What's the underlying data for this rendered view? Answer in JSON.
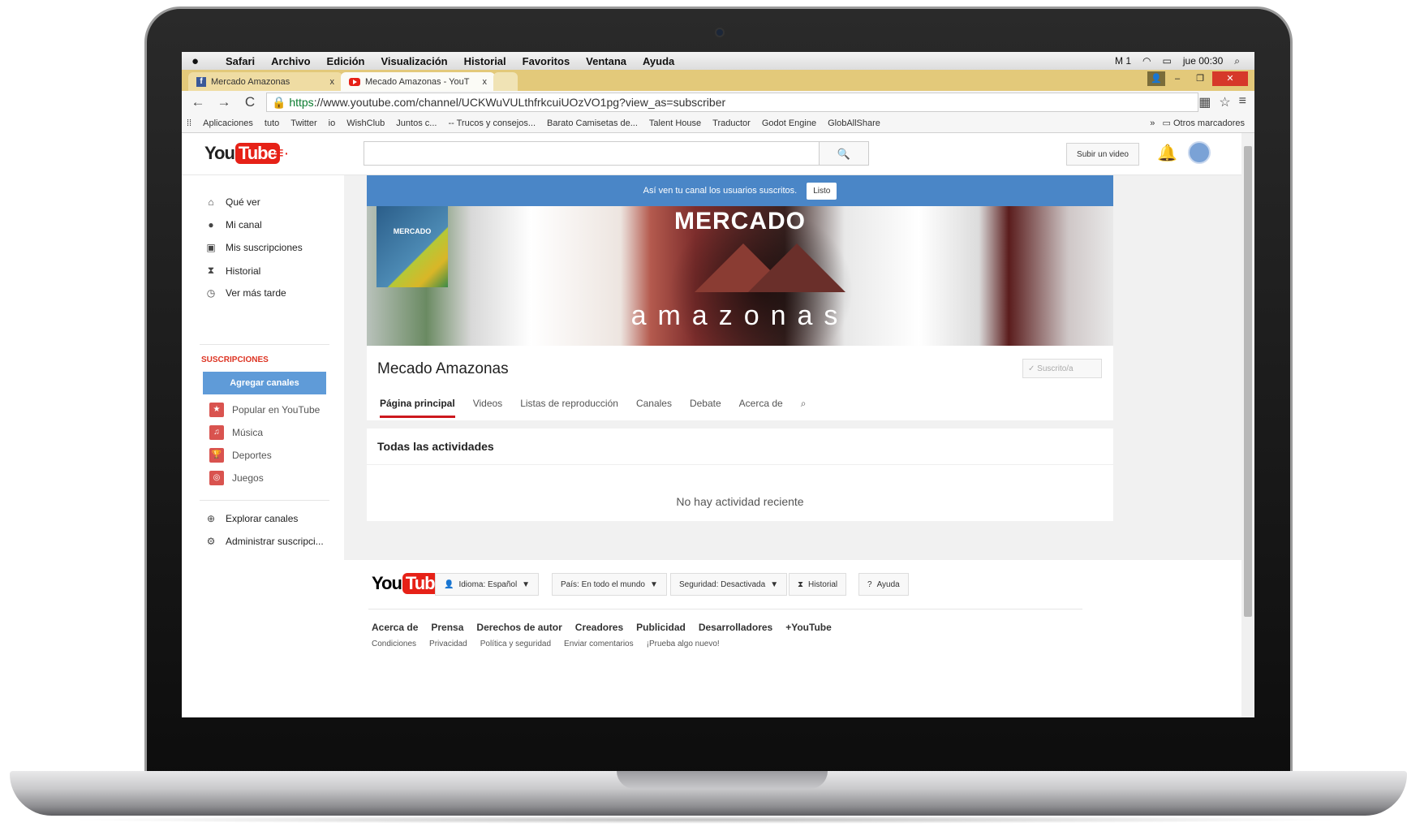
{
  "mac_menu": {
    "apple": "",
    "items": [
      "Safari",
      "Archivo",
      "Edición",
      "Visualización",
      "Historial",
      "Favoritos",
      "Ventana",
      "Ayuda"
    ],
    "status": {
      "m1": "M 1",
      "clock": "jue 00:30"
    }
  },
  "browser": {
    "tabs": [
      {
        "label": "Mercado Amazonas",
        "close": "x"
      },
      {
        "label": "Mecado Amazonas - YouT",
        "close": "x"
      }
    ],
    "url_https": "https",
    "url_rest": "://www.youtube.com/channel/UCKWuVULthfrkcuiUOzVO1pg?view_as=subscriber",
    "bookmarks": [
      "Aplicaciones",
      "tuto",
      "Twitter",
      "io",
      "WishClub",
      "Juntos c...",
      "-- Trucos y consejos...",
      "Barato Camisetas de...",
      "Talent House",
      "Traductor",
      "Godot Engine",
      "GlobAllShare"
    ],
    "bookmarks_more": "»",
    "other_bookmarks": "Otros marcadores"
  },
  "youtube": {
    "logo_you": "You",
    "logo_tube": "Tube",
    "upload_label": "Subir un video",
    "guide": {
      "items": [
        "Qué ver",
        "Mi canal",
        "Mis suscripciones",
        "Historial",
        "Ver más tarde"
      ],
      "subs_header": "SUSCRIPCIONES",
      "add_channels": "Agregar canales",
      "subs": [
        "Popular en YouTube",
        "Música",
        "Deportes",
        "Juegos"
      ],
      "bottom": [
        "Explorar canales",
        "Administrar suscripci..."
      ]
    },
    "notice": {
      "text": "Así ven tu canal los usuarios suscritos.",
      "button": "Listo"
    },
    "banner": {
      "top": "MERCADO",
      "bottom": "amazonas",
      "thumb": "MERCADO"
    },
    "channel_name": "Mecado Amazonas",
    "subscribed": "✓ Suscrito/a",
    "tabs": [
      "Página principal",
      "Videos",
      "Listas de reproducción",
      "Canales",
      "Debate",
      "Acerca de"
    ],
    "activity": {
      "header": "Todas las actividades",
      "empty": "No hay actividad reciente"
    },
    "footer": {
      "language": "Idioma: Español",
      "country": "País: En todo el mundo",
      "safety": "Seguridad: Desactivada",
      "history": "Historial",
      "help": "Ayuda",
      "links": [
        "Acerca de",
        "Prensa",
        "Derechos de autor",
        "Creadores",
        "Publicidad",
        "Desarrolladores",
        "+YouTube"
      ],
      "small": [
        "Condiciones",
        "Privacidad",
        "Política y seguridad",
        "Enviar comentarios",
        "¡Prueba algo nuevo!"
      ]
    }
  }
}
